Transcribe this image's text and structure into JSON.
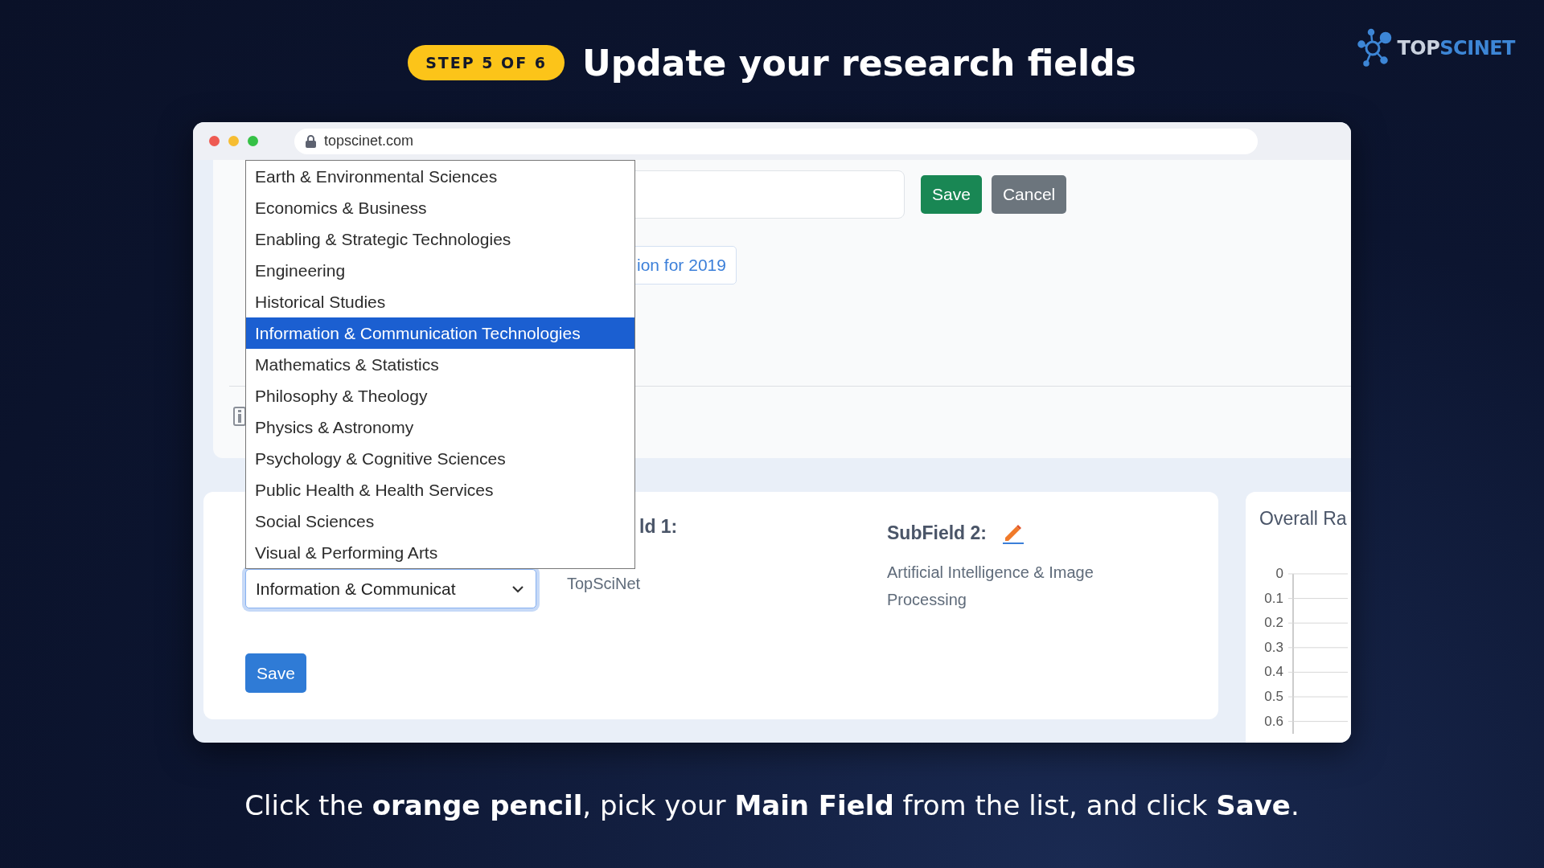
{
  "slide": {
    "step_badge": "STEP 5 OF 6",
    "title": "Update your research fields",
    "logo": {
      "text_light": "TOP",
      "text_accent": "SCINET"
    },
    "caption": "Click the **orange pencil**, pick your **Main Field** from the list, and click **Save**."
  },
  "browser": {
    "address": "topscinet.com"
  },
  "top_card": {
    "save_button": "Save",
    "cancel_button": "Cancel",
    "link_button": "ion for 2019"
  },
  "fields_card": {
    "select": {
      "value": "Information & Communicat",
      "expanded": true,
      "options": [
        {
          "label": "Earth & Environmental Sciences",
          "selected": false
        },
        {
          "label": "Economics & Business",
          "selected": false
        },
        {
          "label": "Enabling & Strategic Technologies",
          "selected": false
        },
        {
          "label": "Engineering",
          "selected": false
        },
        {
          "label": "Historical Studies",
          "selected": false
        },
        {
          "label": "Information & Communication Technologies",
          "selected": true
        },
        {
          "label": "Mathematics & Statistics",
          "selected": false
        },
        {
          "label": "Philosophy & Theology",
          "selected": false
        },
        {
          "label": "Physics & Astronomy",
          "selected": false
        },
        {
          "label": "Psychology & Cognitive Sciences",
          "selected": false
        },
        {
          "label": "Public Health & Health Services",
          "selected": false
        },
        {
          "label": "Social Sciences",
          "selected": false
        },
        {
          "label": "Visual & Performing Arts",
          "selected": false
        }
      ]
    },
    "save_button": "Save",
    "subfield_1": {
      "heading": "ld 1:",
      "value": "TopSciNet"
    },
    "subfield_2": {
      "heading": "SubField 2:",
      "value": "Artificial Intelligence & Image Processing"
    }
  },
  "chart_panel": {
    "title": "Overall Ra",
    "y_ticks": [
      "0",
      "0.1",
      "0.2",
      "0.3",
      "0.4",
      "0.5",
      "0.6"
    ]
  }
}
